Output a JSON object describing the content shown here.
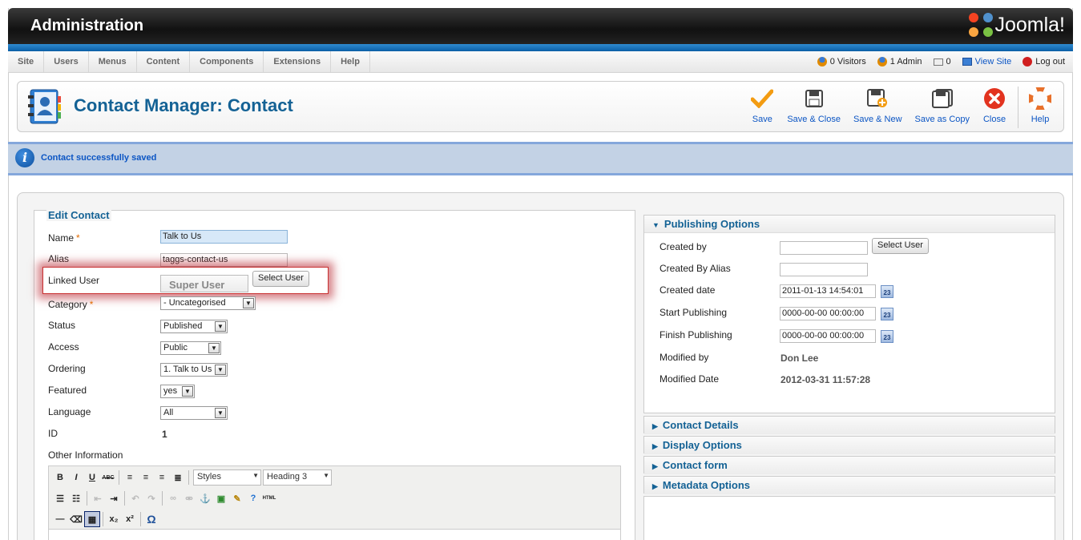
{
  "header": {
    "title": "Administration",
    "logo_text": "Joomla!"
  },
  "menu": [
    "Site",
    "Users",
    "Menus",
    "Content",
    "Components",
    "Extensions",
    "Help"
  ],
  "status": {
    "visitors": "0 Visitors",
    "admins": "1 Admin",
    "messages": "0",
    "view_site": "View Site",
    "logout": "Log out"
  },
  "page": {
    "title": "Contact Manager: Contact",
    "icon": "contact-book-icon"
  },
  "toolbar": {
    "save": "Save",
    "save_close": "Save & Close",
    "save_new": "Save & New",
    "save_copy": "Save as Copy",
    "close": "Close",
    "help": "Help"
  },
  "message": "Contact successfully saved",
  "edit": {
    "legend": "Edit Contact",
    "name_label": "Name",
    "name_value": "Talk to Us",
    "alias_label": "Alias",
    "alias_value": "taggs-contact-us",
    "linked_user_label": "Linked User",
    "linked_user_placeholder": "Super User",
    "select_user": "Select User",
    "category_label": "Category",
    "category_value": "- Uncategorised",
    "status_label": "Status",
    "status_value": "Published",
    "access_label": "Access",
    "access_value": "Public",
    "ordering_label": "Ordering",
    "ordering_value": "1. Talk to Us",
    "featured_label": "Featured",
    "featured_value": "yes",
    "language_label": "Language",
    "language_value": "All",
    "id_label": "ID",
    "id_value": "1",
    "other_info_label": "Other Information",
    "required_mark": "*"
  },
  "editor": {
    "styles": "Styles",
    "format": "Heading 3",
    "bold": "B",
    "italic": "I",
    "underline": "U",
    "strike": "ABC",
    "html": "HTML",
    "omega": "Ω"
  },
  "publishing": {
    "title": "Publishing Options",
    "created_by_label": "Created by",
    "created_by_value": "",
    "select_user": "Select User",
    "created_alias_label": "Created By Alias",
    "created_alias_value": "",
    "created_date_label": "Created date",
    "created_date_value": "2011-01-13 14:54:01",
    "start_label": "Start Publishing",
    "start_value": "0000-00-00 00:00:00",
    "finish_label": "Finish Publishing",
    "finish_value": "0000-00-00 00:00:00",
    "modified_by_label": "Modified by",
    "modified_by_value": "Don Lee",
    "modified_date_label": "Modified Date",
    "modified_date_value": "2012-03-31 11:57:28",
    "cal_text": "23"
  },
  "panels": [
    "Contact Details",
    "Display Options",
    "Contact form",
    "Metadata Options"
  ]
}
